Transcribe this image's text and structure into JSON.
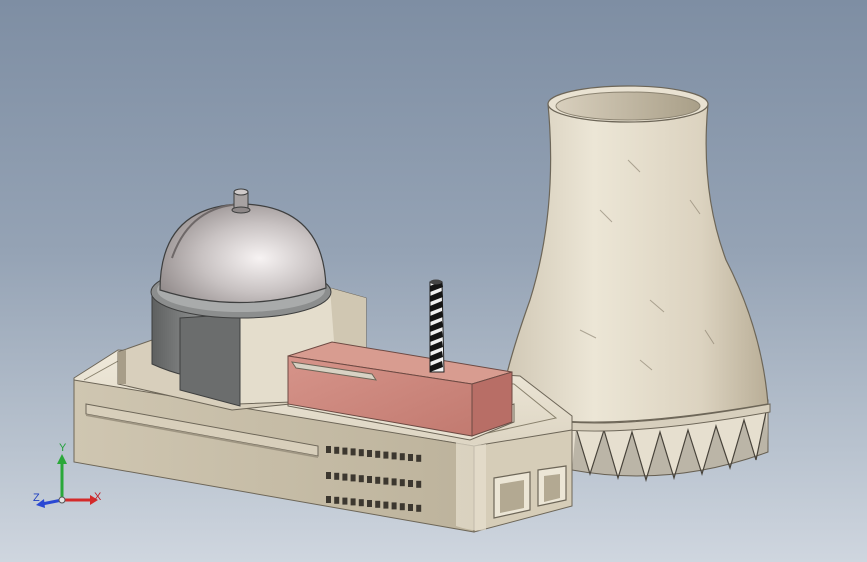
{
  "viewport": {
    "background_top": "#7e8ea3",
    "background_bottom": "#cfd6df"
  },
  "model": {
    "parts": [
      "reactor-dome",
      "reactor-building",
      "turbine-hall",
      "exhaust-stack",
      "cooling-tower"
    ]
  },
  "triad": {
    "x_label": "X",
    "y_label": "Y",
    "z_label": "Z",
    "x_color": "#d42a2a",
    "y_color": "#2aa83a",
    "z_color": "#2a48d4"
  }
}
